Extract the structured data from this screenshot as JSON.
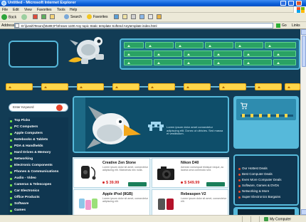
{
  "window": {
    "title": "Untitled - Microsoft Internet Explorer"
  },
  "menu": [
    "File",
    "Edit",
    "View",
    "Favorites",
    "Tools",
    "Help"
  ],
  "toolbar": {
    "back_label": "Back",
    "search_label": "Search",
    "favorites_label": "Favorites"
  },
  "address": {
    "label": "Address",
    "value": "D:\\[unsit\\Tesoro]\\0x89;0*\\Shravs-1100 Any topic Static template Softend Anytemplate index.html",
    "go_label": "Go",
    "links_label": "Links"
  },
  "site": {
    "search_placeholder": "Enter Keyword",
    "categories": [
      "Top Picks",
      "PC Computers",
      "Apple Computers",
      "Notebooks & Tablets",
      "PDA & Handhelds",
      "Hard Drives & Memory",
      "Networking",
      "Electronic Components",
      "Phones & Communications",
      "Audio - Video",
      "Cameras & Telescopes",
      "Car Electronics",
      "Office Products",
      "Software",
      "Games"
    ],
    "banner_text": "Lorem ipsum dolor amet consectetur adipiscing elit. Donec ut ultricies. Sed massa et vestibulum.",
    "products": [
      {
        "name": "Creative Zen Stone",
        "desc": "Lorem ipsum dolor sit amet, consectetur adipiscing elit. Maecenas nec nulla.",
        "price": "$ 39.99"
      },
      {
        "name": "Nikon D40",
        "desc": "Aenean consequat tristique neque, ac lacinia urna commodo sed.",
        "price": "$ 549.99"
      },
      {
        "name": "Apple iPod (8GB)",
        "desc": "Lorem ipsum dolor sit amet, consectetur adipiscing elit.",
        "price": ""
      },
      {
        "name": "Rebeaspen V2",
        "desc": "Lorem ipsum dolor sit amet, consectetur elit.",
        "price": ""
      }
    ],
    "deals": [
      "Our Hottest Deals",
      "Best Computer Deals",
      "Even More Computer Deals",
      "Software, Games & DVDs",
      "Networking & More",
      "Super Electronics Bargains"
    ]
  },
  "status": {
    "left": "",
    "zone": "My Computer"
  },
  "colors": {
    "page_bg": "#123c55",
    "nav_green": "#2aa264",
    "accent_yellow": "#ffd64a",
    "frame_blue": "#56b9da",
    "price_red": "#d32020"
  }
}
